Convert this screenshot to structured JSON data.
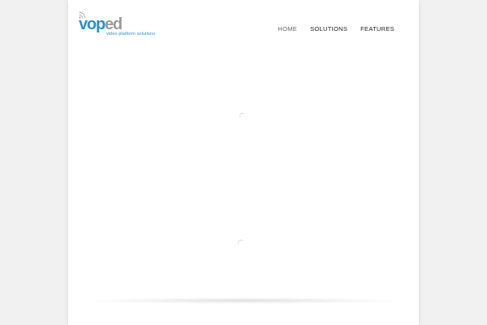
{
  "header": {
    "rss_icon": "rss-icon",
    "logo": {
      "part1": "vop",
      "part2": "ed",
      "tagline": "video platform solutions",
      "colors": {
        "primary": "#2b8fd0",
        "secondary": "#9a9a9a"
      }
    }
  },
  "nav": {
    "items": [
      {
        "label": "HOME",
        "active": true
      },
      {
        "label": "SOLUTIONS",
        "active": false
      },
      {
        "label": "FEATURES",
        "active": false
      }
    ]
  },
  "content": {
    "loaders": [
      "loading-spinner-icon",
      "loading-spinner-icon"
    ]
  }
}
